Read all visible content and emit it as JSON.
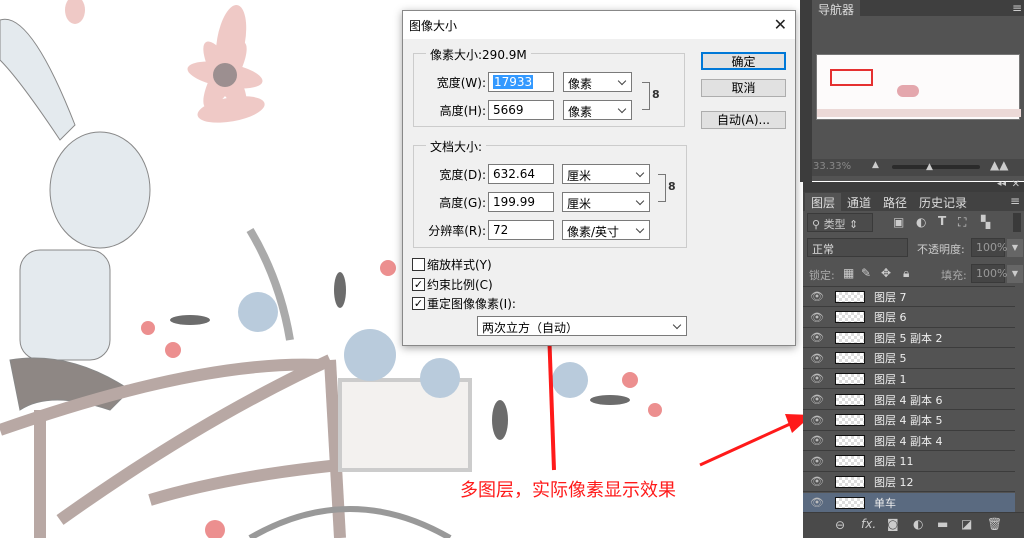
{
  "dialog": {
    "title": "图像大小",
    "pixel_size_label": "像素大小:290.9M",
    "width_label": "宽度(W):",
    "width_value": "17933",
    "width_unit": "像素",
    "height_label": "高度(H):",
    "height_value": "5669",
    "height_unit": "像素",
    "doc_size_label": "文档大小:",
    "doc_width_label": "宽度(D):",
    "doc_width_value": "632.64",
    "doc_width_unit": "厘米",
    "doc_height_label": "高度(G):",
    "doc_height_value": "199.99",
    "doc_height_unit": "厘米",
    "resolution_label": "分辨率(R):",
    "resolution_value": "72",
    "resolution_unit": "像素/英寸",
    "scale_styles": {
      "label": "缩放样式(Y)",
      "checked": false
    },
    "constrain": {
      "label": "约束比例(C)",
      "checked": true
    },
    "resample": {
      "label": "重定图像像素(I):",
      "checked": true
    },
    "resample_method": "两次立方（自动）",
    "ok": "确定",
    "cancel": "取消",
    "auto": "自动(A)..."
  },
  "navigator": {
    "tab": "导航器",
    "zoom": "33.33%"
  },
  "layers_panel": {
    "tabs": [
      "图层",
      "通道",
      "路径",
      "历史记录"
    ],
    "filter": "类型",
    "blend_mode": "正常",
    "opacity_label": "不透明度:",
    "opacity": "100%",
    "lock_label": "锁定:",
    "fill_label": "填充:",
    "fill": "100%",
    "layers": [
      "图层 7",
      "图层 6",
      "图层 5 副本 2",
      "图层 5",
      "图层 1",
      "图层 4 副本 6",
      "图层 4 副本 5",
      "图层 4 副本 4",
      "图层 11",
      "图层 12",
      "单车"
    ],
    "active_layer": "单车"
  },
  "annotation": {
    "text": "多图层，实际像素显示效果",
    "color": "#ff1a1a"
  }
}
